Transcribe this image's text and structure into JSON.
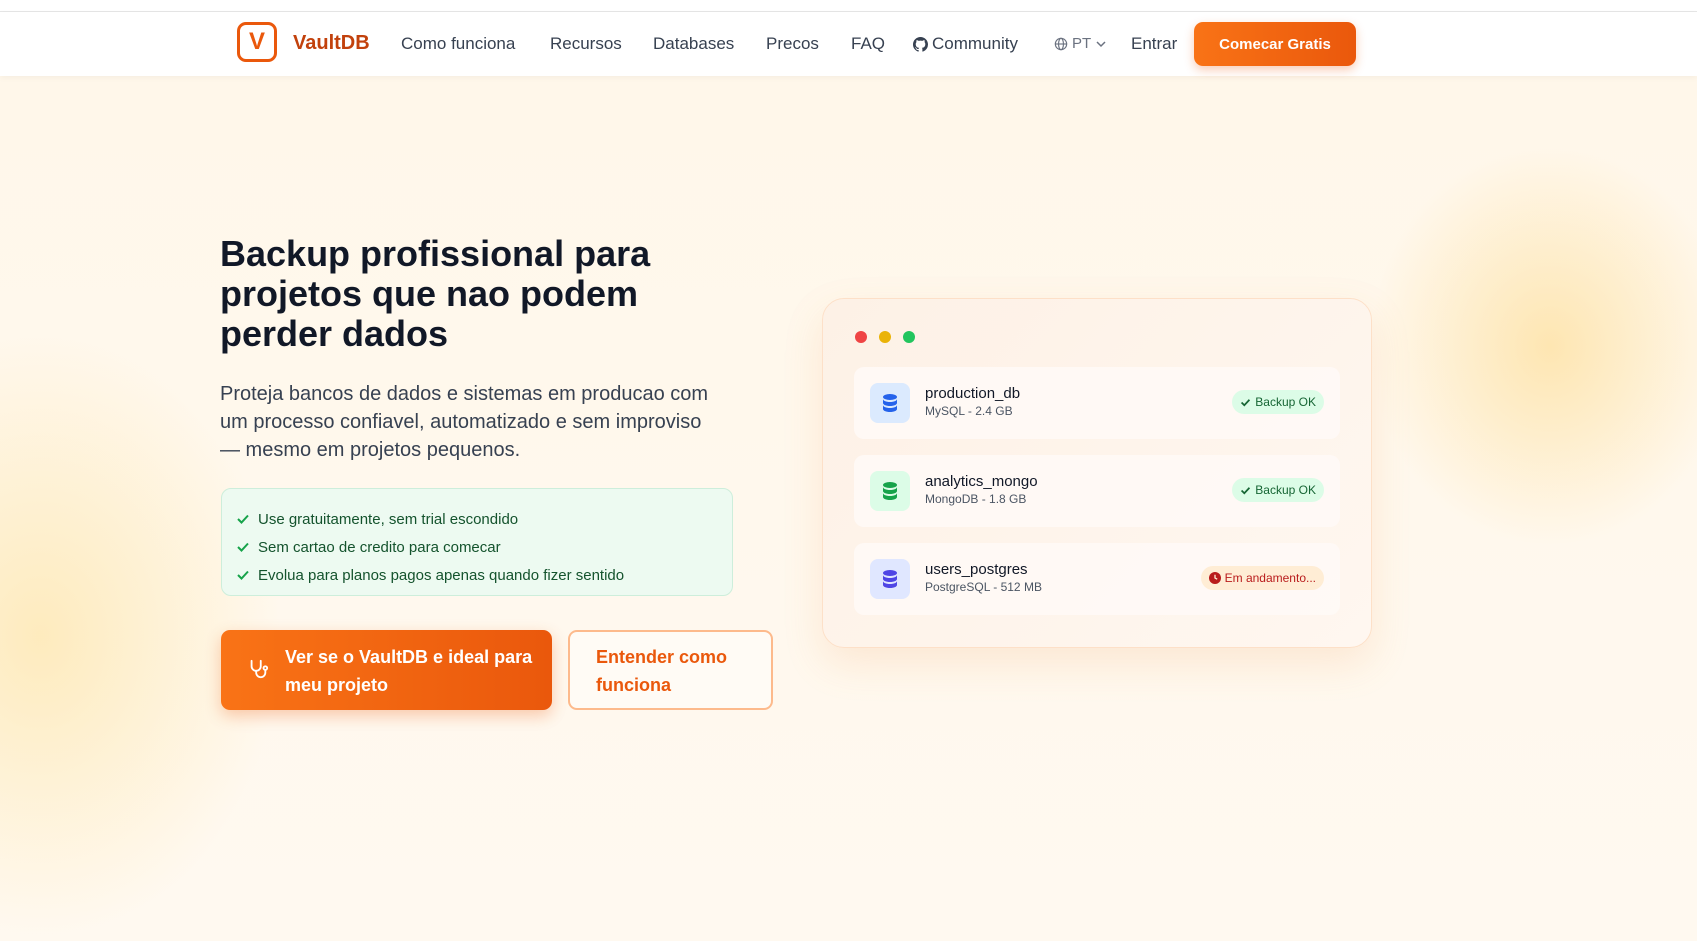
{
  "brand": {
    "logo_letter": "V",
    "name": "VaultDB"
  },
  "nav": {
    "links": [
      "Como funciona",
      "Recursos",
      "Databases",
      "Precos",
      "FAQ",
      "Community"
    ],
    "language": "PT",
    "login": "Entrar",
    "cta": "Comecar Gratis"
  },
  "hero": {
    "headline": "Backup profissional para projetos que nao podem perder dados",
    "subtext": "Proteja bancos de dados e sistemas em producao com um processo confiavel, automatizado e sem improviso — mesmo em projetos pequenos.",
    "checks": [
      "Use gratuitamente, sem trial escondido",
      "Sem cartao de credito para comecar",
      "Evolua para planos pagos apenas quando fizer sentido"
    ],
    "primary_button": "Ver se o VaultDB e ideal para meu projeto",
    "secondary_button": "Entender como funciona"
  },
  "dashboard": {
    "databases": [
      {
        "name": "production_db",
        "meta": "MySQL - 2.4 GB",
        "status": "Backup OK",
        "status_type": "ok",
        "icon_color": "#2563eb",
        "icon_bg": "#dbeafe"
      },
      {
        "name": "analytics_mongo",
        "meta": "MongoDB - 1.8 GB",
        "status": "Backup OK",
        "status_type": "ok",
        "icon_color": "#16a34a",
        "icon_bg": "#dcfce7"
      },
      {
        "name": "users_postgres",
        "meta": "PostgreSQL - 512 MB",
        "status": "Em andamento...",
        "status_type": "progress",
        "icon_color": "#4f46e5",
        "icon_bg": "#e0e7ff"
      }
    ]
  },
  "colors": {
    "accent": "#ea580c",
    "accent_light": "#f97316",
    "success": "#16a34a",
    "window_red": "#ef4444",
    "window_yellow": "#eab308",
    "window_green": "#22c55e"
  },
  "icons": [
    "github-icon",
    "globe-icon",
    "chevron-down-icon",
    "stethoscope-icon",
    "check-icon",
    "database-icon",
    "clock-icon"
  ]
}
